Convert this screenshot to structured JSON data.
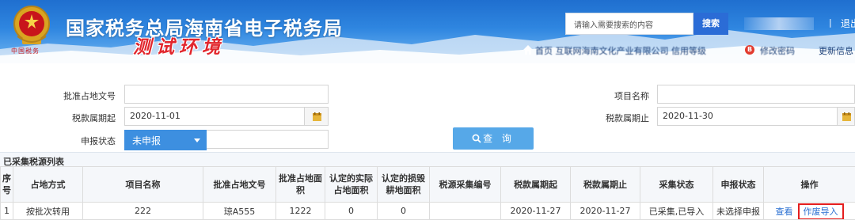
{
  "header": {
    "title": "国家税务总局海南省电子税务局",
    "env_label": "测试环境",
    "seal_text": "中国税务",
    "search_placeholder": "请输入需要搜索的内容",
    "search_button": "搜索",
    "separator": "|",
    "logout": "退出",
    "info_text": "首页   互联网海南文化产业有限公司   信用等级",
    "badge": "B",
    "info_text2": "修改密码",
    "update_link": "更新信息"
  },
  "form": {
    "approval_no_label": "批准占地文号",
    "approval_no_value": "",
    "project_name_label": "项目名称",
    "project_name_value": "",
    "period_start_label": "税款属期起",
    "period_start_value": "2020-11-01",
    "period_end_label": "税款属期止",
    "period_end_value": "2020-11-30",
    "declare_status_label": "申报状态",
    "declare_status_value": "未申报",
    "query_button": "查 询"
  },
  "table": {
    "title": "已采集税源列表",
    "headers": [
      "序号",
      "占地方式",
      "项目名称",
      "批准占地文号",
      "批准占地面积",
      "认定的实际占地面积",
      "认定的损毁耕地面积",
      "税源采集编号",
      "税款属期起",
      "税款属期止",
      "采集状态",
      "申报状态",
      "操作"
    ],
    "rows": [
      {
        "seq": "1",
        "method": "按批次转用",
        "project": "222",
        "approval_no": "琼A555",
        "approved_area": "1222",
        "actual_area": "0",
        "damaged_area": "0",
        "source_no": "",
        "period_start": "2020-11-27",
        "period_end": "2020-11-27",
        "collect_status": "已采集,已导入",
        "declare_status": "未选择申报",
        "op_view": "查看",
        "op_void": "作废导入"
      }
    ]
  },
  "colors": {
    "header_blue": "#2f86e0",
    "env_red": "#e1262d",
    "select_blue": "#3d8fe0",
    "query_blue": "#56a8e8",
    "highlight_red": "#e41e1e"
  }
}
